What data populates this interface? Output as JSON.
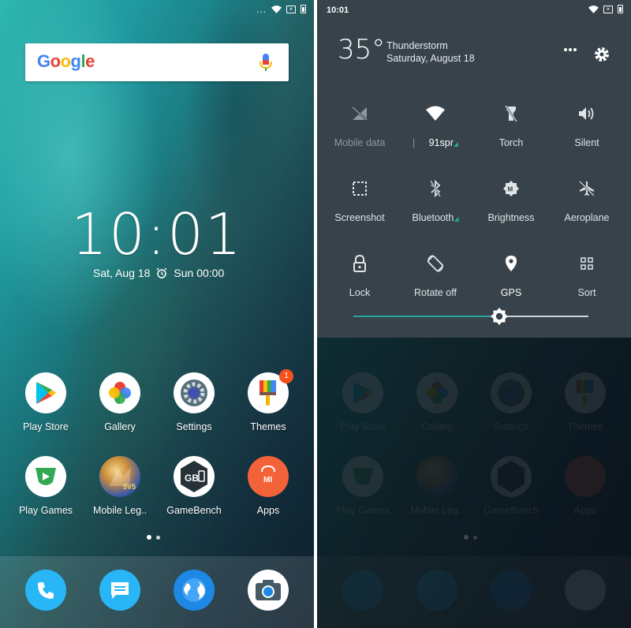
{
  "left": {
    "statusbar": {
      "dots": "..."
    },
    "search": {
      "logo_text": "Google"
    },
    "clock": {
      "time": "10:01",
      "date": "Sat, Aug 18",
      "alarm": "Sun 00:00"
    },
    "apps": [
      {
        "label": "Play Store",
        "icon": "play-store-icon"
      },
      {
        "label": "Gallery",
        "icon": "gallery-pinwheel-icon"
      },
      {
        "label": "Settings",
        "icon": "settings-gear-icon"
      },
      {
        "label": "Themes",
        "icon": "themes-brush-icon",
        "badge": "1"
      },
      {
        "label": "Play Games",
        "icon": "play-games-icon"
      },
      {
        "label": "Mobile Leg..",
        "icon": "mobile-legends-icon"
      },
      {
        "label": "GameBench",
        "icon": "gamebench-icon"
      },
      {
        "label": "Apps",
        "icon": "mi-apps-icon"
      }
    ],
    "dock": [
      "phone-icon",
      "messages-icon",
      "browser-globe-icon",
      "camera-icon"
    ]
  },
  "right": {
    "statusbar": {
      "time": "10:01"
    },
    "weather": {
      "temperature": "35°",
      "condition": "Thunderstorm",
      "date": "Saturday, August 18"
    },
    "tiles": [
      {
        "label": "Mobile data",
        "icon": "mobile-data-off-icon",
        "state": "off"
      },
      {
        "label": "91spr",
        "icon": "wifi-icon",
        "state": "on"
      },
      {
        "label": "Torch",
        "icon": "torch-icon",
        "state": "normal"
      },
      {
        "label": "Silent",
        "icon": "volume-icon",
        "state": "normal"
      },
      {
        "label": "Screenshot",
        "icon": "screenshot-icon",
        "state": "normal"
      },
      {
        "label": "Bluetooth",
        "icon": "bluetooth-icon",
        "state": "normal"
      },
      {
        "label": "Brightness",
        "icon": "brightness-auto-icon",
        "state": "normal"
      },
      {
        "label": "Aeroplane",
        "icon": "airplane-icon",
        "state": "normal"
      },
      {
        "label": "Lock",
        "icon": "lock-icon",
        "state": "normal"
      },
      {
        "label": "Rotate off",
        "icon": "rotate-icon",
        "state": "normal"
      },
      {
        "label": "GPS",
        "icon": "location-pin-icon",
        "state": "on"
      },
      {
        "label": "Sort",
        "icon": "grid-sort-icon",
        "state": "normal"
      }
    ],
    "brightness": {
      "level": 0.62
    }
  },
  "colors": {
    "shade_bg": "#37424a",
    "accent": "#26a69a",
    "badge": "#f4511e"
  }
}
